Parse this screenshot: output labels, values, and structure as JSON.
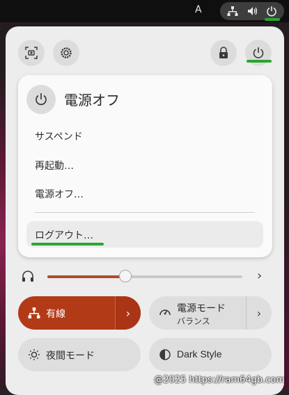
{
  "topbar": {
    "input_indicator": "A",
    "status_icons": [
      "network-wired-icon",
      "volume-icon",
      "power-icon"
    ]
  },
  "quick_settings": {
    "top_buttons": [
      "screenshot-icon",
      "settings-icon",
      "lock-icon",
      "power-icon"
    ]
  },
  "power_menu": {
    "title": "電源オフ",
    "items": [
      "サスペンド",
      "再起動…",
      "電源オフ…"
    ],
    "logout_label": "ログアウト…"
  },
  "volume": {
    "level": 0.4
  },
  "toggles": {
    "wired": {
      "label": "有線",
      "active": true
    },
    "power_mode": {
      "label": "電源モード",
      "sublabel": "バランス"
    },
    "night_light": {
      "label": "夜間モード"
    },
    "dark_style": {
      "label": "Dark Style"
    }
  },
  "watermark": "@2025 https://ram64gb.com",
  "colors": {
    "accent": "#b33a17",
    "highlight_green": "#2aa532",
    "panel_bg": "#ededed"
  }
}
